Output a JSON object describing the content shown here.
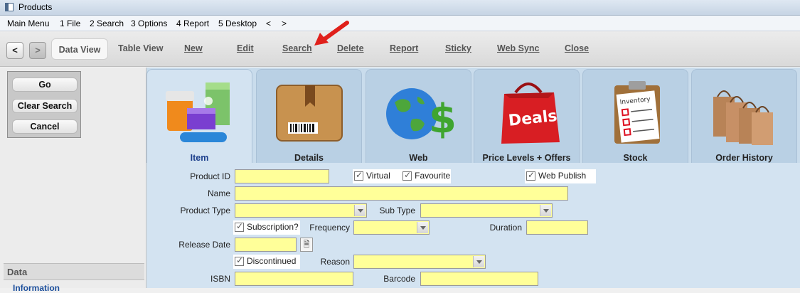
{
  "window": {
    "title": "Products"
  },
  "menu": [
    "Main Menu",
    "1 File",
    "2 Search",
    "3 Options",
    "4 Report",
    "5 Desktop",
    "<",
    ">"
  ],
  "toolbar": {
    "back": "<",
    "forward": ">",
    "data_view": "Data View",
    "table_view": "Table View",
    "new": "New",
    "edit": "Edit",
    "search": "Search",
    "delete": "Delete",
    "report": "Report",
    "sticky": "Sticky",
    "web_sync": "Web Sync",
    "close": "Close"
  },
  "left": {
    "go": "Go",
    "clear_search": "Clear Search",
    "cancel": "Cancel",
    "data_header": "Data",
    "data_item": "Information"
  },
  "tabs": [
    {
      "label": "Item",
      "icon": "products-icon",
      "active": true
    },
    {
      "label": "Details",
      "icon": "box-icon"
    },
    {
      "label": "Web",
      "icon": "globe-dollar-icon"
    },
    {
      "label": "Price Levels + Offers",
      "icon": "deals-bag-icon"
    },
    {
      "label": "Stock",
      "icon": "inventory-clipboard-icon"
    },
    {
      "label": "Order History",
      "icon": "shopping-bags-icon"
    }
  ],
  "form": {
    "product_id": {
      "label": "Product ID",
      "value": ""
    },
    "virtual": {
      "label": "Virtual",
      "checked": true
    },
    "favourite": {
      "label": "Favourite",
      "checked": true
    },
    "web_publish": {
      "label": "Web Publish",
      "checked": true
    },
    "name": {
      "label": "Name",
      "value": ""
    },
    "product_type": {
      "label": "Product Type",
      "value": ""
    },
    "sub_type": {
      "label": "Sub Type",
      "value": ""
    },
    "subscription": {
      "label": "Subscription?",
      "checked": true
    },
    "frequency": {
      "label": "Frequency",
      "value": ""
    },
    "duration": {
      "label": "Duration",
      "value": ""
    },
    "release_date": {
      "label": "Release Date",
      "value": ""
    },
    "discontinued": {
      "label": "Discontinued",
      "checked": true
    },
    "reason": {
      "label": "Reason",
      "value": ""
    },
    "isbn": {
      "label": "ISBN",
      "value": ""
    },
    "barcode": {
      "label": "Barcode",
      "value": ""
    }
  },
  "colors": {
    "field_bg": "#ffff99",
    "tab_bg": "#b9d0e4",
    "form_bg": "#d3e3f1",
    "arrow": "#e0201b"
  }
}
